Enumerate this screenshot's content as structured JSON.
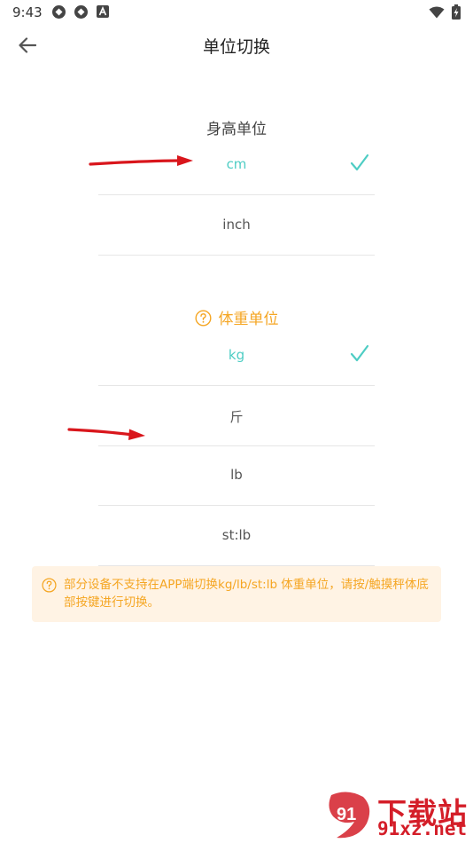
{
  "status_bar": {
    "time": "9:43",
    "icons": [
      "sync-icon",
      "sync-icon",
      "font-a-icon",
      "wifi-icon",
      "battery-charging-icon"
    ]
  },
  "header": {
    "title": "单位切换",
    "back_icon": "arrow-left-icon"
  },
  "height_section": {
    "title": "身高单位",
    "options": [
      {
        "label": "cm",
        "selected": true
      },
      {
        "label": "inch",
        "selected": false
      }
    ]
  },
  "weight_section": {
    "title": "体重单位",
    "options": [
      {
        "label": "kg",
        "selected": true
      },
      {
        "label": "斤",
        "selected": false
      },
      {
        "label": "lb",
        "selected": false
      },
      {
        "label": "st:lb",
        "selected": false
      }
    ]
  },
  "notice": {
    "text": "部分设备不支持在APP端切换kg/lb/st:lb 体重单位，请按/触摸秤体底部按键进行切换。"
  },
  "watermark": {
    "logo_text": "91",
    "title": "下载站",
    "url": "91xz.net"
  },
  "colors": {
    "accent": "#4ecdc4",
    "warning": "#f5a623",
    "notice_bg": "#fff3e4",
    "annotation_arrow": "#d9161c",
    "watermark": "#d41e29"
  }
}
